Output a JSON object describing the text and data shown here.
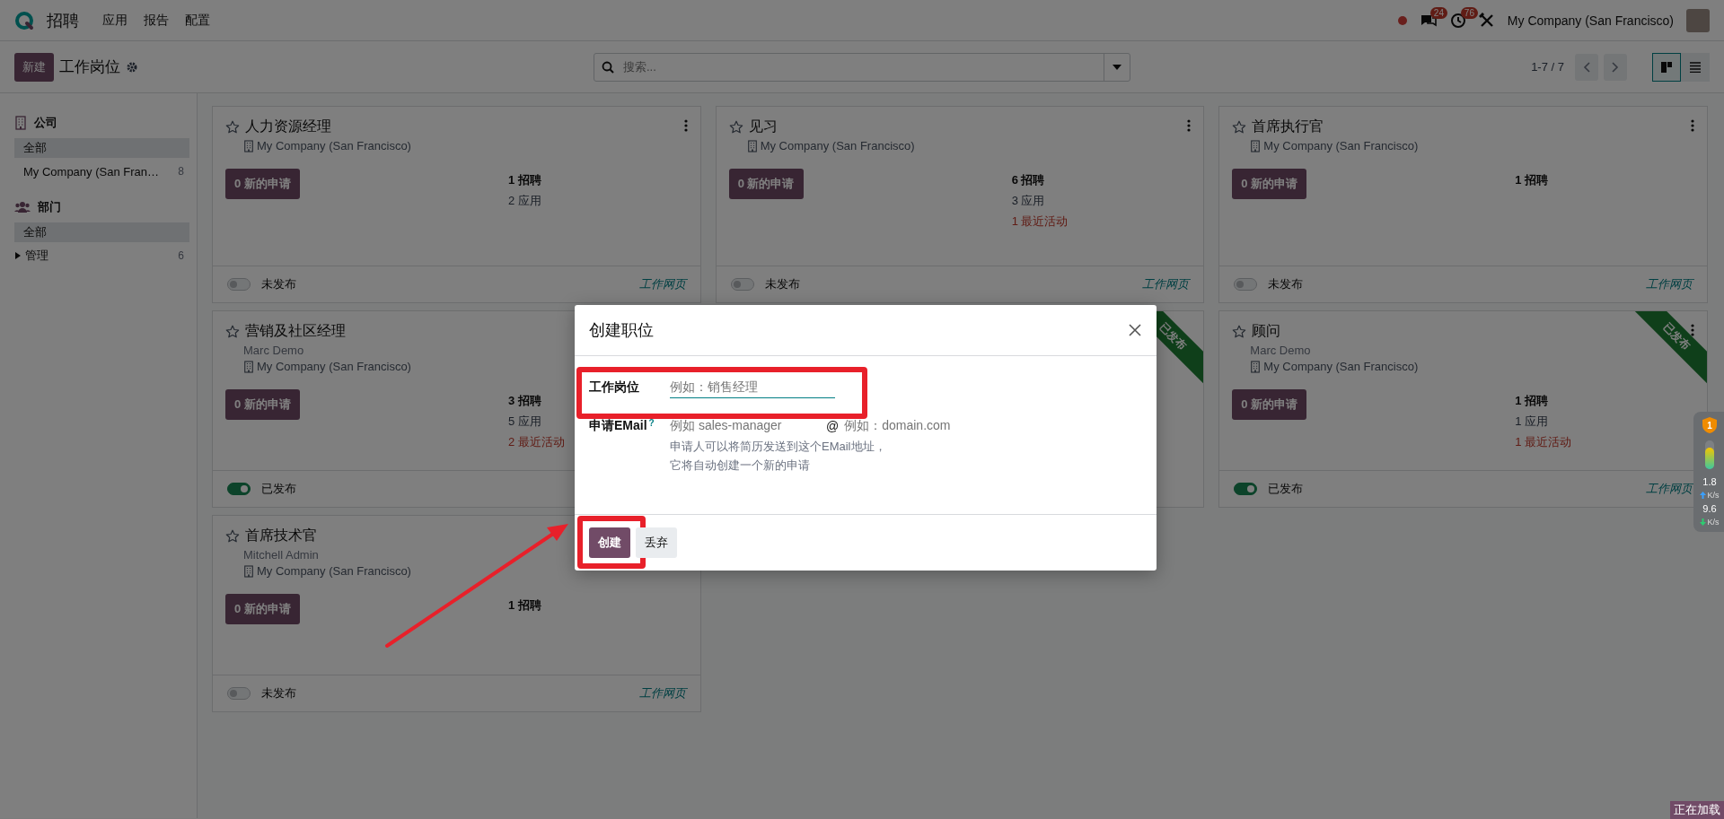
{
  "navbar": {
    "app_name": "招聘",
    "menus": [
      "应用",
      "报告",
      "配置"
    ],
    "messages_count": "24",
    "activities_count": "76",
    "company": "My Company (San Francisco)"
  },
  "control_panel": {
    "new_button": "新建",
    "title": "工作岗位",
    "search": {
      "placeholder": "搜索..."
    },
    "pager": "1-7 / 7",
    "view_switch": [
      {
        "kind": "kanban",
        "selected": true
      },
      {
        "kind": "list",
        "selected": false
      }
    ]
  },
  "sidebar": {
    "sections": [
      {
        "kind": "company",
        "title": "公司",
        "items": [
          {
            "label": "全部",
            "selected": true
          },
          {
            "label": "My Company (San Fran…",
            "count": "8",
            "selected": false
          }
        ]
      },
      {
        "kind": "department",
        "title": "部门",
        "items": [
          {
            "label": "全部",
            "selected": true
          },
          {
            "label": "管理",
            "count": "6",
            "selected": false,
            "expanded": false
          }
        ]
      }
    ]
  },
  "cards": [
    {
      "title": "人力资源经理",
      "favorite": false,
      "menu": true,
      "company": "My Company (San Francisco)",
      "new_button": "0 新的申请",
      "stats": [
        {
          "kind": "recruiting",
          "text": "1 招聘"
        },
        {
          "kind": "applications",
          "text": "2 应用"
        }
      ],
      "published": false,
      "status_label": "未发布",
      "link": "工作网页"
    },
    {
      "title": "见习",
      "favorite": false,
      "menu": true,
      "company": "My Company (San Francisco)",
      "new_button": "0 新的申请",
      "stats": [
        {
          "kind": "recruiting",
          "text": "6 招聘"
        },
        {
          "kind": "applications",
          "text": "3 应用"
        },
        {
          "kind": "activities",
          "text": "1 最近活动"
        }
      ],
      "published": false,
      "status_label": "未发布",
      "link": "工作网页"
    },
    {
      "title": "首席执行官",
      "favorite": false,
      "menu": true,
      "company": "My Company (San Francisco)",
      "new_button": "0 新的申请",
      "stats": [
        {
          "kind": "recruiting",
          "text": "1 招聘"
        }
      ],
      "published": false,
      "status_label": "未发布",
      "link": "工作网页"
    },
    {
      "title": "营销及社区经理",
      "favorite": false,
      "manager": "Marc Demo",
      "company": "My Company (San Francisco)",
      "new_button": "0 新的申请",
      "stats": [
        {
          "kind": "recruiting",
          "text": "3 招聘"
        },
        {
          "kind": "applications",
          "text": "5 应用"
        },
        {
          "kind": "activities",
          "text": "2 最近活动"
        }
      ],
      "published": true,
      "status_label": "已发布"
    },
    {
      "ribbon": "已发布"
    },
    {
      "title": "顾问",
      "favorite": false,
      "menu": true,
      "manager": "Marc Demo",
      "company": "My Company (San Francisco)",
      "new_button": "0 新的申请",
      "stats": [
        {
          "kind": "recruiting",
          "text": "1 招聘"
        },
        {
          "kind": "applications",
          "text": "1 应用"
        },
        {
          "kind": "activities",
          "text": "1 最近活动"
        }
      ],
      "published": true,
      "status_label": "已发布",
      "link": "工作网页",
      "ribbon": "已发布"
    },
    {
      "title": "首席技术官",
      "favorite": false,
      "manager": "Mitchell Admin",
      "company": "My Company (San Francisco)",
      "new_button": "0 新的申请",
      "stats": [
        {
          "kind": "recruiting",
          "text": "1 招聘"
        }
      ],
      "published": false,
      "status_label": "未发布",
      "link": "工作网页"
    }
  ],
  "dialog": {
    "title": "创建职位",
    "fields": [
      {
        "kind": "text",
        "label": "工作岗位",
        "placeholder": "例如：销售经理",
        "highlighted": true
      },
      {
        "kind": "email",
        "label": "申请EMail",
        "help_mark": "?",
        "placeholder": "例如 sales-manager",
        "separator": "@",
        "domain_placeholder": "例如：domain.com",
        "help": [
          "申请人可以将简历发送到这个EMail地址，",
          "它将自动创建一个新的申请"
        ]
      }
    ],
    "buttons": [
      {
        "kind": "primary",
        "label": "创建",
        "highlighted": true
      },
      {
        "kind": "secondary",
        "label": "丢弃"
      }
    ]
  },
  "net_widget": {
    "badge": "1",
    "upload": {
      "value": "1.8",
      "unit": "K/s"
    },
    "download": {
      "value": "9.6",
      "unit": "K/s"
    }
  },
  "loading": "正在加载"
}
